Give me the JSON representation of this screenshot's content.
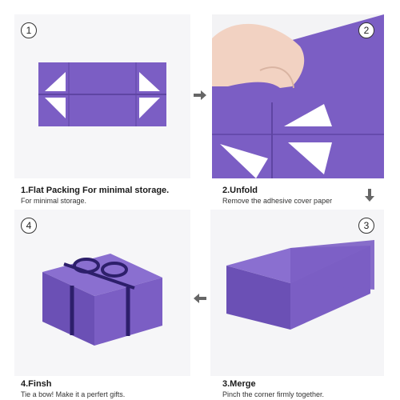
{
  "colors": {
    "box_purple": "#7b5ec4",
    "box_dark": "#5f45a3",
    "ribbon": "#2d1f6b"
  },
  "steps": [
    {
      "number": "1",
      "title": "1.Flat Packing For minimal storage.",
      "subtitle": "For minimal storage."
    },
    {
      "number": "2",
      "title": "2.Unfold",
      "subtitle": "Remove the adhesive cover paper"
    },
    {
      "number": "3",
      "title": "3.Merge",
      "subtitle": "Pinch the corner firmly together."
    },
    {
      "number": "4",
      "title": "4.Finsh",
      "subtitle": "Tie a bow! Make it a perfert gifts."
    }
  ],
  "icons": [
    "arrow-right-icon",
    "arrow-down-icon",
    "arrow-left-icon"
  ]
}
